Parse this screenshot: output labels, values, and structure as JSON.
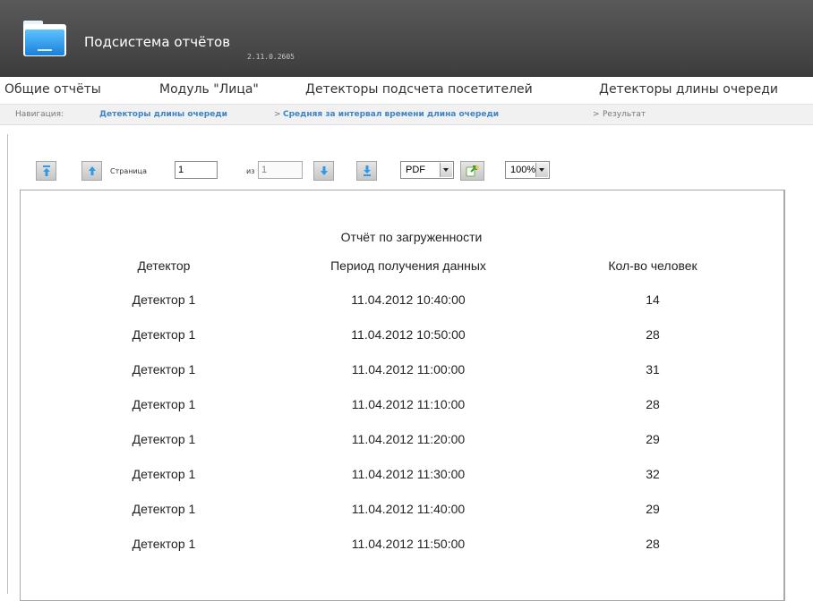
{
  "header": {
    "title": "Подсистема отчётов",
    "version": "2.11.0.2605"
  },
  "menu": {
    "items": [
      {
        "label": "Общие отчёты"
      },
      {
        "label": "Модуль \"Лица\""
      },
      {
        "label": "Детекторы подсчета посетителей"
      },
      {
        "label": "Детекторы длины очереди"
      }
    ]
  },
  "breadcrumb": {
    "prefix": "Навигация:",
    "link1": "Детекторы длины очереди",
    "separator": ">",
    "link2": "Средняя за интервал времени длина очереди",
    "current": "Результат"
  },
  "toolbar": {
    "page_label": "Страница",
    "page_value": "1",
    "of_label": "из",
    "total_pages": "1",
    "format": "PDF",
    "zoom": "100%",
    "icons": [
      "first-page-icon",
      "previous-page-icon",
      "next-page-icon",
      "last-page-icon",
      "export-icon"
    ]
  },
  "report": {
    "title": "Отчёт по загруженности",
    "columns": [
      "Детектор",
      "Период получения данных",
      "Кол-во человек"
    ],
    "rows": [
      [
        "Детектор 1",
        "11.04.2012 10:40:00",
        "14"
      ],
      [
        "Детектор 1",
        "11.04.2012 10:50:00",
        "28"
      ],
      [
        "Детектор 1",
        "11.04.2012 11:00:00",
        "31"
      ],
      [
        "Детектор 1",
        "11.04.2012 11:10:00",
        "28"
      ],
      [
        "Детектор 1",
        "11.04.2012 11:20:00",
        "29"
      ],
      [
        "Детектор 1",
        "11.04.2012 11:30:00",
        "32"
      ],
      [
        "Детектор 1",
        "11.04.2012 11:40:00",
        "29"
      ],
      [
        "Детектор 1",
        "11.04.2012 11:50:00",
        "28"
      ]
    ]
  },
  "colors": {
    "header_bg": "#4a4a4a",
    "link": "#3d85c6",
    "icon_blue": "#2f9be6"
  }
}
